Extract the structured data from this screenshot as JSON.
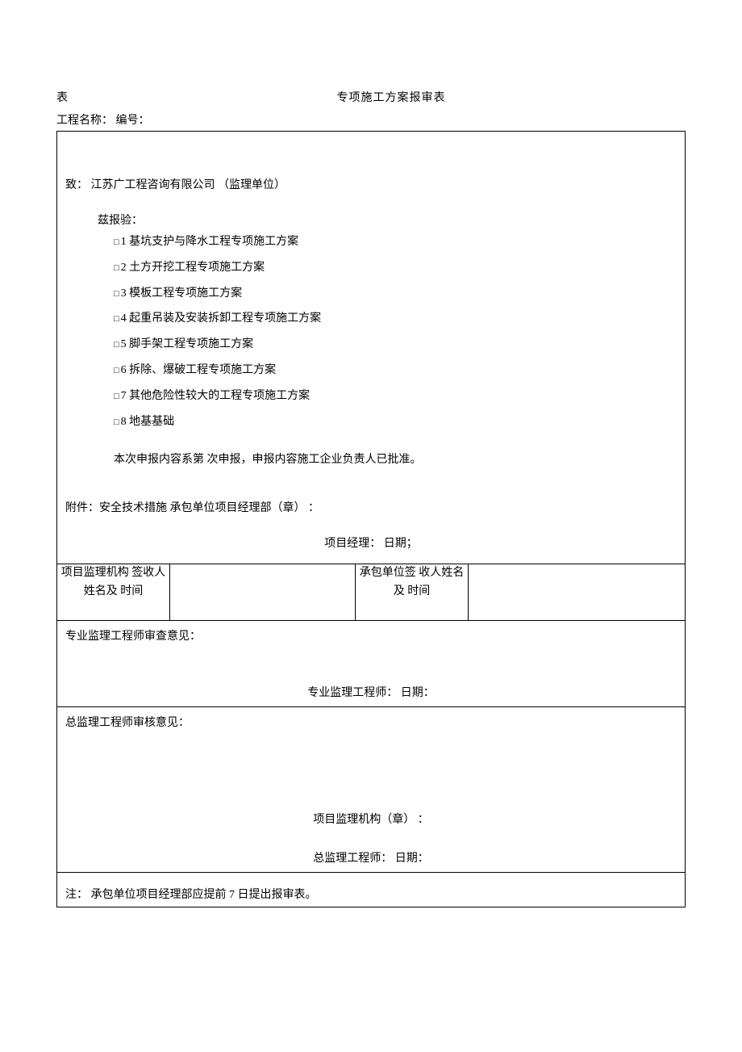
{
  "header": {
    "left": "表",
    "title": "专项施工方案报审表"
  },
  "subheader": "工程名称： 编号：",
  "section1": {
    "address_to": "致： 江苏广工程咨询有限公司 （监理单位）",
    "report_label": "兹报验：",
    "items": [
      "1 基坑支护与降水工程专项施工方案",
      "2 土方开挖工程专项施工方案",
      "3 模板工程专项施工方案",
      "4 起重吊装及安装拆卸工程专项施工方案",
      "5 脚手架工程专项施工方案",
      "6 拆除、爆破工程专项施工方案",
      "7 其他危险性较大的工程专项施工方案",
      "8 地基基础"
    ],
    "declaration": "本次申报内容系第 次申报，申报内容施工企业负责人已批准。",
    "attachment": "附件：安全技术措施 承包单位项目经理部（章） ：",
    "pm_date": "项目经理： 日期；"
  },
  "sign_row": {
    "col1": "项目监理机构 签收人姓名及 时间",
    "col3": "承包单位签 收人姓名及 时间"
  },
  "opinion1": {
    "title": "专业监理工程师审查意见：",
    "sign": "专业监理工程师： 日期："
  },
  "opinion2": {
    "title": "总监理工程师审核意见：",
    "org": "项目监理机构（章） ：",
    "sign": "总监理工程师： 日期："
  },
  "note": "注： 承包单位项目经理部应提前 7 日提出报审表。",
  "checkbox_glyph": "□"
}
